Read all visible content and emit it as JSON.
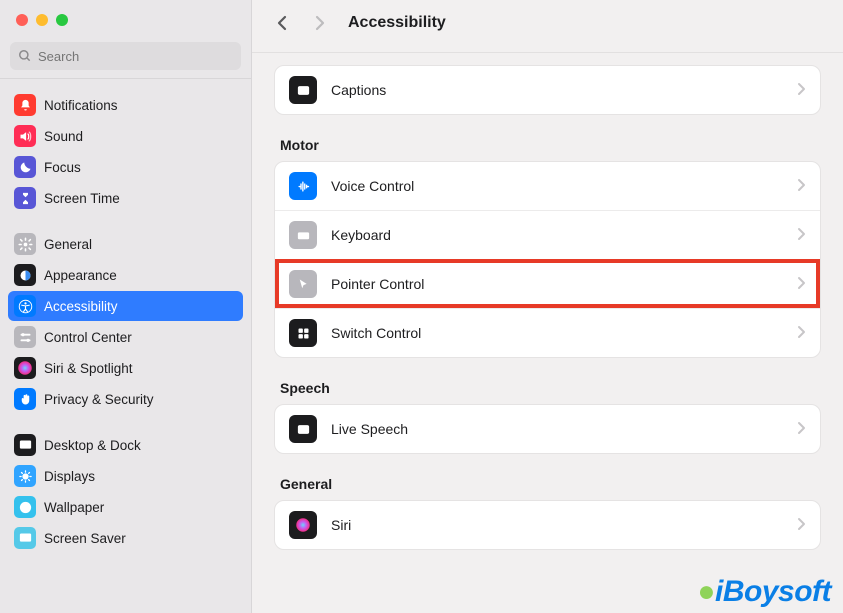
{
  "search": {
    "placeholder": "Search"
  },
  "header": {
    "title": "Accessibility"
  },
  "sidebar": {
    "groups": [
      {
        "items": [
          {
            "label": "Notifications",
            "icon": "bell-icon",
            "iconBg": "#ff3b30"
          },
          {
            "label": "Sound",
            "icon": "speaker-icon",
            "iconBg": "#ff2d55"
          },
          {
            "label": "Focus",
            "icon": "moon-icon",
            "iconBg": "#5856d6"
          },
          {
            "label": "Screen Time",
            "icon": "hourglass-icon",
            "iconBg": "#5856d6"
          }
        ]
      },
      {
        "items": [
          {
            "label": "General",
            "icon": "gear-icon",
            "iconBg": "#b8b7bc"
          },
          {
            "label": "Appearance",
            "icon": "appearance-icon",
            "iconBg": "#1c1c1e"
          },
          {
            "label": "Accessibility",
            "icon": "accessibility-icon",
            "iconBg": "#007aff",
            "active": true
          },
          {
            "label": "Control Center",
            "icon": "switches-icon",
            "iconBg": "#b8b7bc"
          },
          {
            "label": "Siri & Spotlight",
            "icon": "siri-icon",
            "iconBg": "#1c1c1e"
          },
          {
            "label": "Privacy & Security",
            "icon": "hand-icon",
            "iconBg": "#007aff"
          }
        ]
      },
      {
        "items": [
          {
            "label": "Desktop & Dock",
            "icon": "dock-icon",
            "iconBg": "#1c1c1e"
          },
          {
            "label": "Displays",
            "icon": "displays-icon",
            "iconBg": "#30a4ff"
          },
          {
            "label": "Wallpaper",
            "icon": "wallpaper-icon",
            "iconBg": "#34c1ed"
          },
          {
            "label": "Screen Saver",
            "icon": "screensaver-icon",
            "iconBg": "#55c9e8"
          }
        ]
      }
    ]
  },
  "main": {
    "top_section": {
      "items": [
        {
          "label": "Captions",
          "icon": "captions-icon",
          "iconBg": "#1c1c1e"
        }
      ]
    },
    "sections": [
      {
        "title": "Motor",
        "items": [
          {
            "label": "Voice Control",
            "icon": "voicecontrol-icon",
            "iconBg": "#007aff"
          },
          {
            "label": "Keyboard",
            "icon": "keyboard-icon",
            "iconBg": "#b8b7bc"
          },
          {
            "label": "Pointer Control",
            "icon": "pointer-icon",
            "iconBg": "#b8b7bc",
            "highlighted": true
          },
          {
            "label": "Switch Control",
            "icon": "switchcontrol-icon",
            "iconBg": "#1c1c1e"
          }
        ]
      },
      {
        "title": "Speech",
        "items": [
          {
            "label": "Live Speech",
            "icon": "livespeech-icon",
            "iconBg": "#1c1c1e"
          }
        ]
      },
      {
        "title": "General",
        "items": [
          {
            "label": "Siri",
            "icon": "siri-icon",
            "iconBg": "#1c1c1e"
          }
        ]
      }
    ]
  },
  "watermark": "iBoysoft"
}
